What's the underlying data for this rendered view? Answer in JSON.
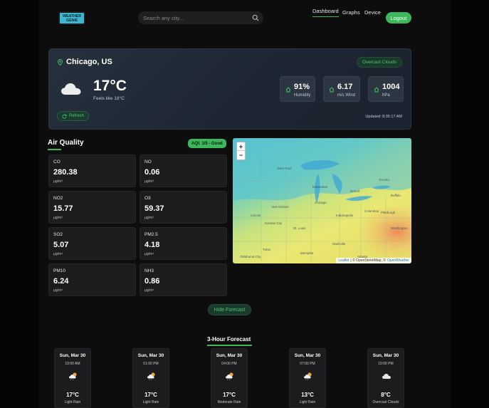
{
  "header": {
    "logo_line1": "WEATHER",
    "logo_line2": "GENIE",
    "search_placeholder": "Search any city...",
    "nav": [
      "Dashboard",
      "Graphs",
      "Device"
    ],
    "logout_label": "Logout"
  },
  "current": {
    "city": "Chicago, US",
    "condition": "Overcast Clouds",
    "temp": "17°C",
    "feels_like": "Feels like 18°C",
    "humidity_value": "91%",
    "humidity_label": "Humidity",
    "wind_value": "6.17",
    "wind_label": "m/s Wind",
    "pressure_value": "1004",
    "pressure_label": "hPa",
    "refresh_label": "Refresh",
    "updated": "Updated: 8:35:17 AM"
  },
  "air_quality": {
    "title": "Air Quality",
    "aqi_badge": "AQI: 1/5 - Good",
    "pollutants": [
      {
        "name": "CO",
        "value": "280.38",
        "unit": "μg/m³"
      },
      {
        "name": "NO",
        "value": "0.06",
        "unit": "μg/m³"
      },
      {
        "name": "NO2",
        "value": "15.77",
        "unit": "μg/m³"
      },
      {
        "name": "O3",
        "value": "59.37",
        "unit": "μg/m³"
      },
      {
        "name": "SO2",
        "value": "5.07",
        "unit": "μg/m³"
      },
      {
        "name": "PM2.5",
        "value": "4.18",
        "unit": "μg/m³"
      },
      {
        "name": "PM10",
        "value": "6.24",
        "unit": "μg/m³"
      },
      {
        "name": "NH3",
        "value": "0.86",
        "unit": "μg/m³"
      }
    ]
  },
  "map": {
    "zoom_in": "+",
    "zoom_out": "−",
    "attribution_leaflet": "Leaflet",
    "attribution_osm": "| © OpenStreetMap, ©",
    "attribution_ow": "OpenWeather",
    "labels": [
      "Saint Paul",
      "Milwaukee",
      "Chicago",
      "Des Moines",
      "Lincoln",
      "Kansas City",
      "St. Louis",
      "Indianapolis",
      "Columbus",
      "Detroit",
      "Tulsa",
      "Oklahoma City",
      "Memphis",
      "Nashville",
      "Atlanta",
      "Toronto",
      "Buffalo",
      "Pittsburgh",
      "Washington"
    ]
  },
  "forecast": {
    "toggle_label": "Hide Forecast",
    "title": "3-Hour Forecast",
    "items": [
      {
        "day": "Sun, Mar 30",
        "time": "10:00 AM",
        "temp": "17°C",
        "desc": "Light Rain",
        "icon": "sun-cloud-rain-icon"
      },
      {
        "day": "Sun, Mar 30",
        "time": "01:00 PM",
        "temp": "17°C",
        "desc": "Light Rain",
        "icon": "sun-cloud-rain-icon"
      },
      {
        "day": "Sun, Mar 30",
        "time": "04:00 PM",
        "temp": "17°C",
        "desc": "Moderate Rain",
        "icon": "sun-cloud-rain-icon"
      },
      {
        "day": "Sun, Mar 30",
        "time": "07:00 PM",
        "temp": "13°C",
        "desc": "Light Rain",
        "icon": "sun-cloud-rain-icon"
      },
      {
        "day": "Sun, Mar 30",
        "time": "10:00 PM",
        "temp": "8°C",
        "desc": "Overcast Clouds",
        "icon": "cloud-icon"
      }
    ]
  },
  "colors": {
    "accent": "#3cb75c",
    "background": "#0d0d0e",
    "card": "#1c1c1f",
    "logo": "#3fb6cf"
  }
}
